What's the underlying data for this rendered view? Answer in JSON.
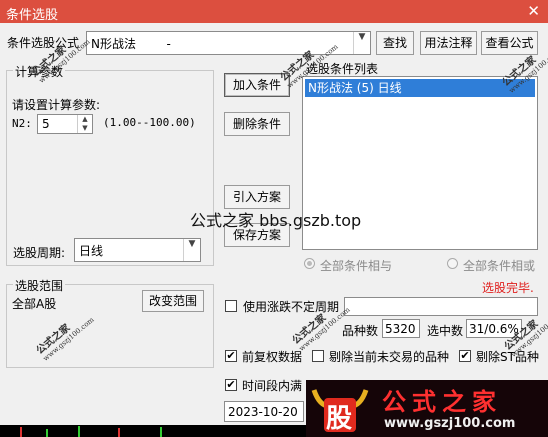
{
  "window": {
    "title": "条件选股",
    "close_glyph": "✕"
  },
  "formula": {
    "label": "条件选股公式",
    "value": "N形战法        -",
    "find_label": "查找",
    "usage_label": "用法注释",
    "view_label": "查看公式"
  },
  "params": {
    "group_title": "计算参数",
    "prompt": "请设置计算参数:",
    "n2_label": "N2:",
    "n2_value": "5",
    "n2_range": "(1.00--100.00)"
  },
  "period": {
    "label": "选股周期:",
    "value": "日线"
  },
  "range": {
    "group_title": "选股范围",
    "value": "全部A股",
    "change_label": "改变范围"
  },
  "actions": {
    "add": "加入条件",
    "delete": "删除条件",
    "import": "引入方案",
    "save": "保存方案"
  },
  "conditions": {
    "title": "选股条件列表",
    "items": [
      "N形战法 (5) 日线"
    ],
    "and_label": "全部条件相与",
    "or_label": "全部条件相或"
  },
  "status": {
    "text": "选股完毕.",
    "color": "#e0201e"
  },
  "options": {
    "uncertain_label": "使用涨跌不定周期",
    "count_label": "品种数",
    "count_value": "5320",
    "selected_label": "选中数",
    "selected_value": "31/0.6%",
    "adjust_label": "前复权数据",
    "exclude_untraded_label": "剔除当前未交易的品种",
    "exclude_st_label": "剔除ST品种",
    "timerange_label": "时间段内满",
    "date_value": "2023-10-20"
  },
  "watermarks": {
    "center": "公式之家 bbs.gszb.top",
    "stamp_title": "公式之家",
    "stamp_url": "www.gszj100.com",
    "banner_glyph": "股",
    "banner_title": "公式之家",
    "banner_url": "www.gszj100.com"
  }
}
